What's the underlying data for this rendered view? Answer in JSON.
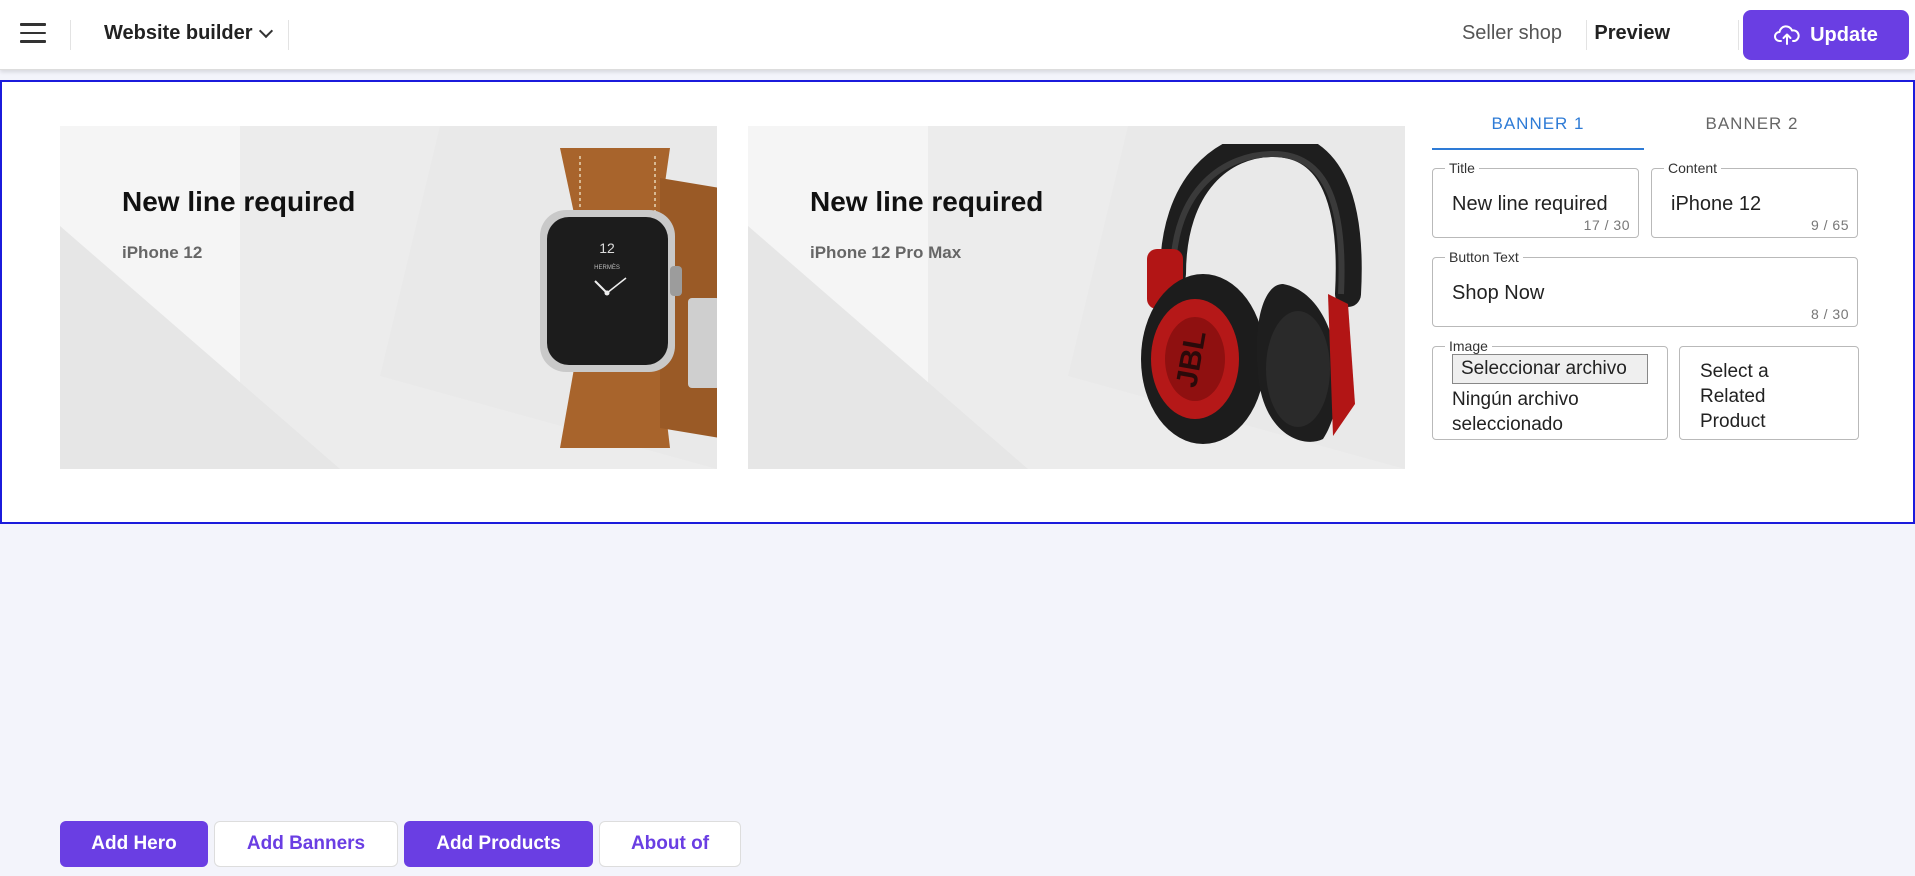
{
  "topbar": {
    "menu_icon": "hamburger-icon",
    "builder_label": "Website builder",
    "seller_label": "Seller shop",
    "preview_label": "Preview",
    "update_label": "Update",
    "update_icon": "cloud-upload-icon"
  },
  "banners": [
    {
      "title": "New line required",
      "subtitle": "iPhone 12",
      "image": "watch-image"
    },
    {
      "title": "New line required",
      "subtitle": "iPhone 12 Pro Max",
      "image": "headphones-image"
    }
  ],
  "editor": {
    "tabs": [
      {
        "label": "BANNER 1",
        "active": true
      },
      {
        "label": "BANNER 2",
        "active": false
      }
    ],
    "title_field": {
      "legend": "Title",
      "value": "New line required",
      "count": "17 / 30"
    },
    "content_field": {
      "legend": "Content",
      "value": "iPhone 12",
      "count": "9 / 65"
    },
    "button_text_field": {
      "legend": "Button Text",
      "value": "Shop Now",
      "count": "8 / 30"
    },
    "image_field": {
      "legend": "Image",
      "button": "Seleccionar archivo",
      "status": "Ningún archivo seleccionado"
    },
    "related_product": "Select a Related Product"
  },
  "bottom_buttons": [
    {
      "label": "Add Hero",
      "style": "filled"
    },
    {
      "label": "Add Banners",
      "style": "outline"
    },
    {
      "label": "Add Products",
      "style": "filled"
    },
    {
      "label": "About of",
      "style": "outline"
    }
  ],
  "colors": {
    "accent": "#6a3ee3",
    "tab_active": "#2e7bd6",
    "panel_border": "#1b1bdc",
    "page_bg": "#f3f4fb"
  }
}
